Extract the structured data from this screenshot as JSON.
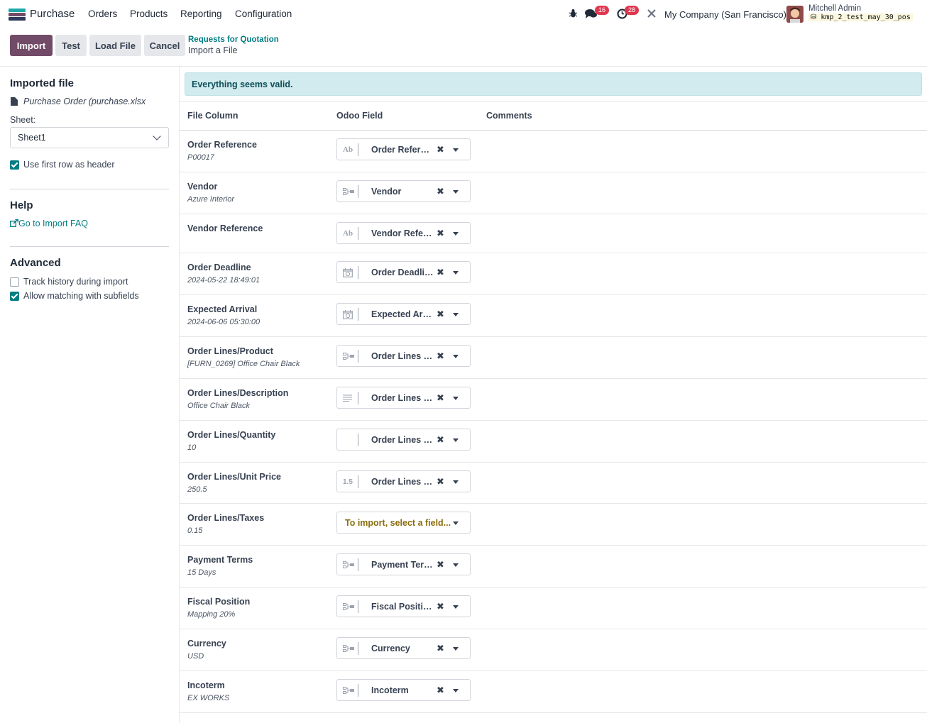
{
  "navbar": {
    "app_name": "Purchase",
    "menu": [
      "Orders",
      "Products",
      "Reporting",
      "Configuration"
    ],
    "messages_count": "16",
    "activities_count": "28",
    "company": "My Company (San Francisco)",
    "user_name": "Mitchell Admin",
    "db_name": "kmp_2_test_may_30_pos",
    "logo_colors": [
      "#1ea8a8",
      "#714b67",
      "#2f3a5c"
    ]
  },
  "control_panel": {
    "import_label": "Import",
    "test_label": "Test",
    "load_file_label": "Load File",
    "cancel_label": "Cancel",
    "breadcrumb_parent": "Requests for Quotation",
    "breadcrumb_current": "Import a File"
  },
  "sidebar": {
    "imported_file_title": "Imported file",
    "file_name": "Purchase Order (purchase.xlsx",
    "sheet_label": "Sheet:",
    "sheet_value": "Sheet1",
    "first_row_header_label": "Use first row as header",
    "help_title": "Help",
    "faq_link": "Go to Import FAQ",
    "advanced_title": "Advanced",
    "track_history_label": "Track history during import",
    "allow_matching_label": "Allow matching with subfields"
  },
  "main": {
    "alert": "Everything seems valid.",
    "headers": {
      "file_column": "File Column",
      "odoo_field": "Odoo Field",
      "comments": "Comments"
    },
    "rows": [
      {
        "name": "Order Reference",
        "sample": "P00017",
        "type": "Ab",
        "field": "Order Reference"
      },
      {
        "name": "Vendor",
        "sample": "Azure Interior",
        "type": "rel",
        "field": "Vendor"
      },
      {
        "name": "Vendor Reference",
        "sample": "",
        "type": "Ab",
        "field": "Vendor Reference"
      },
      {
        "name": "Order Deadline",
        "sample": "2024-05-22 18:49:01",
        "type": "date",
        "field": "Order Deadline"
      },
      {
        "name": "Expected Arrival",
        "sample": "2024-06-06 05:30:00",
        "type": "date",
        "field": "Expected Arrival"
      },
      {
        "name": "Order Lines/Product",
        "sample": "[FURN_0269] Office Chair Black",
        "type": "rel",
        "field": "Order Lines / Product"
      },
      {
        "name": "Order Lines/Description",
        "sample": "Office Chair Black",
        "type": "text",
        "field": "Order Lines / Description"
      },
      {
        "name": "Order Lines/Quantity",
        "sample": "10",
        "type": "",
        "field": "Order Lines / Quantity"
      },
      {
        "name": "Order Lines/Unit Price",
        "sample": "250.5",
        "type": "1.5",
        "field": "Order Lines / Unit Price"
      },
      {
        "name": "Order Lines/Taxes",
        "sample": "0.15",
        "type": "none",
        "field": "To import, select a field..."
      },
      {
        "name": "Payment Terms",
        "sample": "15 Days",
        "type": "rel",
        "field": "Payment Terms"
      },
      {
        "name": "Fiscal Position",
        "sample": "Mapping 20%",
        "type": "rel",
        "field": "Fiscal Position"
      },
      {
        "name": "Currency",
        "sample": "USD",
        "type": "rel",
        "field": "Currency"
      },
      {
        "name": "Incoterm",
        "sample": "EX WORKS",
        "type": "rel",
        "field": "Incoterm"
      }
    ]
  }
}
